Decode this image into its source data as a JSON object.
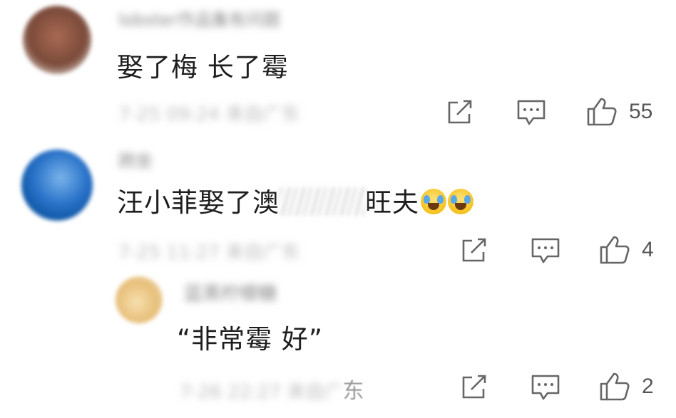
{
  "comments": [
    {
      "username": "lobster作品集有问题",
      "text": "娶了梅 长了霉",
      "meta": "7-25 09:24 来自广东",
      "likes": "55"
    },
    {
      "username": "跨坐",
      "text_before": "汪小菲娶了澳",
      "text_after": "旺夫",
      "meta": "7-25 11:27 来自广东",
      "likes": "4"
    }
  ],
  "reply": {
    "username": "蓝黑柠檬糖",
    "text": "“非常霉 好”",
    "meta_blurred": "7-26 22:27 来自广",
    "meta_visible": "东",
    "likes": "2"
  },
  "icons": {
    "share": "share-icon",
    "reply": "comment-icon",
    "like": "thumbs-up-icon",
    "emoji": "laughing-crying-emoji-icon"
  }
}
